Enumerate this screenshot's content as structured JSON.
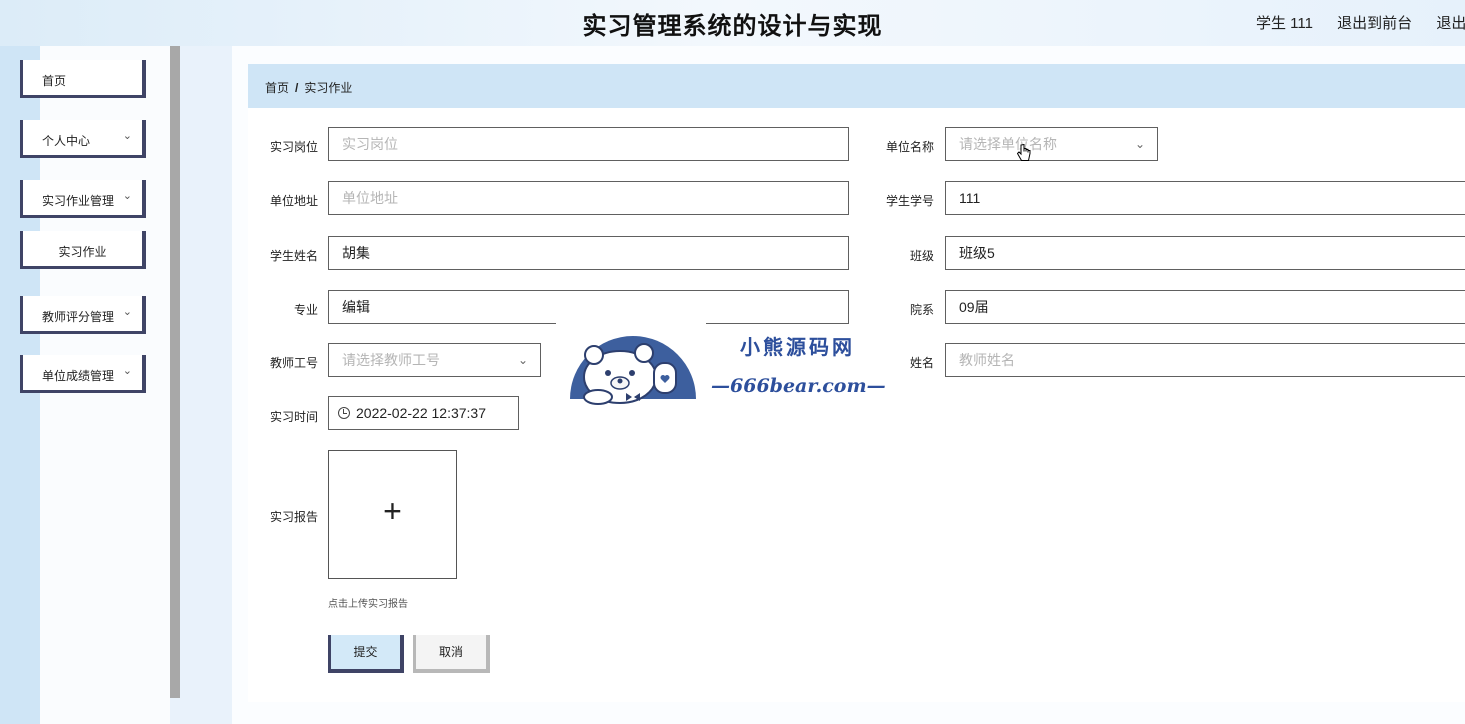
{
  "header": {
    "title": "实习管理系统的设计与实现",
    "user": "学生 111",
    "back_to_front": "退出到前台",
    "logout": "退出登"
  },
  "sidebar": {
    "items": [
      {
        "label": "首页",
        "has_arrow": false
      },
      {
        "label": "个人中心",
        "has_arrow": true
      },
      {
        "label": "实习作业管理",
        "has_arrow": true
      },
      {
        "label": "实习作业",
        "has_arrow": false,
        "sub": true
      },
      {
        "label": "教师评分管理",
        "has_arrow": true
      },
      {
        "label": "单位成绩管理",
        "has_arrow": true
      }
    ]
  },
  "breadcrumb": {
    "home": "首页",
    "sep": "/",
    "current": "实习作业"
  },
  "form": {
    "position": {
      "label": "实习岗位",
      "placeholder": "实习岗位",
      "value": ""
    },
    "company_name": {
      "label": "单位名称",
      "placeholder": "请选择单位名称",
      "value": ""
    },
    "company_address": {
      "label": "单位地址",
      "placeholder": "单位地址",
      "value": ""
    },
    "student_no": {
      "label": "学生学号",
      "value": "111"
    },
    "student_name": {
      "label": "学生姓名",
      "value": "胡集"
    },
    "class": {
      "label": "班级",
      "value": "班级5"
    },
    "major": {
      "label": "专业",
      "value": "编辑"
    },
    "department": {
      "label": "院系",
      "value": "09届"
    },
    "teacher_no": {
      "label": "教师工号",
      "placeholder": "请选择教师工号",
      "value": ""
    },
    "teacher_name": {
      "label": "姓名",
      "placeholder": "教师姓名",
      "value": ""
    },
    "intern_time": {
      "label": "实习时间",
      "value": "2022-02-22 12:37:37"
    },
    "report": {
      "label": "实习报告",
      "hint": "点击上传实习报告",
      "plus": "+"
    }
  },
  "buttons": {
    "submit": "提交",
    "cancel": "取消"
  },
  "watermark": {
    "line1": "小熊源码网",
    "line2": "—666bear.com—"
  },
  "colors": {
    "accent": "#3f4466",
    "breadcrumb_bg": "#cfe5f6",
    "submit_bg": "#d3e9f8"
  }
}
